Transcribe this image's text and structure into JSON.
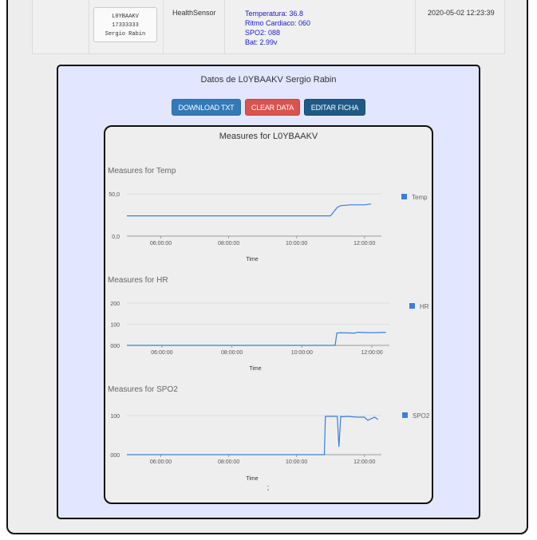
{
  "table": {
    "card": {
      "line1": "L0YBAAKV",
      "line2": "17333333",
      "line3": "Sergio Rabin"
    },
    "type": "HealthSensor",
    "measures": [
      "Temperatura: 36.8",
      "Ritmo Cardiaco: 060",
      "SPO2: 088",
      "Bat: 2.99v"
    ],
    "date": "2020-05-02 12:23:39"
  },
  "panel": {
    "title": "Datos de L0YBAAKV Sergio Rabin",
    "buttons": {
      "download": "DOWNLOAD TXT",
      "clear": "CLEAR DATA",
      "edit": "EDITAR FICHA"
    },
    "measures_title": "Measures for L0YBAAKV",
    "footer_mark": ";"
  },
  "colors": {
    "series": "#3a7ee0",
    "primary": "#337ab7",
    "danger": "#d9534f",
    "dark": "#1e5a86"
  },
  "chart_data": [
    {
      "type": "line",
      "title": "Measures for Temp",
      "xlabel": "Time",
      "series": [
        {
          "name": "Temp",
          "x": [
            5.0,
            6.0,
            7.0,
            8.0,
            9.0,
            10.0,
            10.3,
            11.0,
            11.2,
            11.3,
            11.6,
            12.0,
            12.2
          ],
          "y": [
            24,
            24,
            24,
            24,
            24,
            24,
            24,
            24,
            34,
            36,
            37,
            37,
            38
          ]
        }
      ],
      "xticks": [
        "06:00:00",
        "08:00:00",
        "10:00:00",
        "12:00:00"
      ],
      "yticks": [
        "0,0",
        "50,0"
      ],
      "ylim": [
        0,
        50
      ],
      "legend": "right"
    },
    {
      "type": "line",
      "title": "Measures for HR",
      "xlabel": "Time",
      "series": [
        {
          "name": "HR",
          "x": [
            5.0,
            6.0,
            7.0,
            8.0,
            9.0,
            10.0,
            10.95,
            11.0,
            11.1,
            11.5,
            11.6,
            12.0,
            12.4
          ],
          "y": [
            0,
            0,
            0,
            0,
            0,
            0,
            0,
            58,
            60,
            58,
            62,
            60,
            62
          ]
        }
      ],
      "xticks": [
        "06:00:00",
        "08:00:00",
        "10:00:00",
        "12:00:00"
      ],
      "yticks": [
        "000",
        "100",
        "200"
      ],
      "ylim": [
        0,
        200
      ],
      "legend": "right"
    },
    {
      "type": "line",
      "title": "Measures for SPO2",
      "xlabel": "Time",
      "series": [
        {
          "name": "SPO2",
          "x": [
            5.0,
            6.0,
            7.0,
            8.0,
            9.0,
            10.0,
            10.82,
            10.85,
            11.2,
            11.25,
            11.3,
            11.35,
            11.5,
            11.8,
            12.0,
            12.1,
            12.3,
            12.4
          ],
          "y": [
            0,
            0,
            0,
            0,
            0,
            0,
            0,
            98,
            98,
            20,
            98,
            97,
            98,
            96,
            96,
            88,
            96,
            90
          ]
        }
      ],
      "xticks": [
        "06:00:00",
        "08:00:00",
        "10:00:00",
        "12:00:00"
      ],
      "yticks": [
        "000",
        "100"
      ],
      "ylim": [
        0,
        100
      ],
      "legend": "right"
    }
  ]
}
